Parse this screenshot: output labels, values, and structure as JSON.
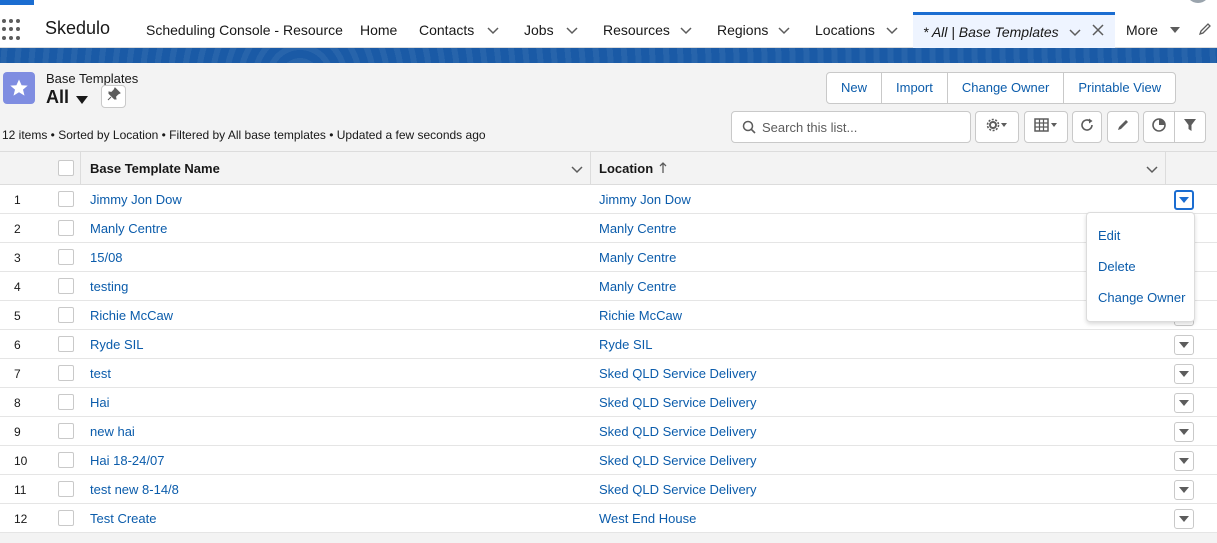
{
  "app": {
    "name": "Skedulo"
  },
  "nav": {
    "items": [
      {
        "label": "Scheduling Console - Resource",
        "has_menu": false
      },
      {
        "label": "Home",
        "has_menu": false
      },
      {
        "label": "Contacts",
        "has_menu": true
      },
      {
        "label": "Jobs",
        "has_menu": true
      },
      {
        "label": "Resources",
        "has_menu": true
      },
      {
        "label": "Regions",
        "has_menu": true
      },
      {
        "label": "Locations",
        "has_menu": true
      }
    ],
    "active_tab": "* All | Base Templates",
    "more_label": "More"
  },
  "header": {
    "object_label": "Base Templates",
    "view_name": "All",
    "buttons": [
      "New",
      "Import",
      "Change Owner",
      "Printable View"
    ],
    "meta": "12 items • Sorted by Location • Filtered by All base templates • Updated a few seconds ago",
    "search_placeholder": "Search this list..."
  },
  "table": {
    "columns": [
      {
        "label": "Base Template Name",
        "sorted": false
      },
      {
        "label": "Location",
        "sorted": true,
        "sort_direction": "ascending"
      }
    ],
    "rows": [
      {
        "num": "1",
        "name": "Jimmy Jon Dow",
        "location": "Jimmy Jon Dow"
      },
      {
        "num": "2",
        "name": "Manly Centre",
        "location": "Manly Centre"
      },
      {
        "num": "3",
        "name": "15/08",
        "location": "Manly Centre"
      },
      {
        "num": "4",
        "name": "testing",
        "location": "Manly Centre"
      },
      {
        "num": "5",
        "name": "Richie McCaw",
        "location": "Richie McCaw"
      },
      {
        "num": "6",
        "name": "Ryde SIL",
        "location": "Ryde SIL"
      },
      {
        "num": "7",
        "name": "test",
        "location": "Sked QLD Service Delivery"
      },
      {
        "num": "8",
        "name": "Hai",
        "location": "Sked QLD Service Delivery"
      },
      {
        "num": "9",
        "name": "new hai",
        "location": "Sked QLD Service Delivery"
      },
      {
        "num": "10",
        "name": "Hai 18-24/07",
        "location": "Sked QLD Service Delivery"
      },
      {
        "num": "11",
        "name": "test new 8-14/8",
        "location": "Sked QLD Service Delivery"
      },
      {
        "num": "12",
        "name": "Test Create",
        "location": "West End House"
      }
    ]
  },
  "row_menu": {
    "items": [
      "Edit",
      "Delete",
      "Change Owner"
    ],
    "open_row": 1
  },
  "colors": {
    "brand": "#1b6dd1",
    "link": "#0b5cab",
    "band": "#1a5aa6",
    "object_icon": "#7f8de1"
  },
  "icons": [
    "waffle-icon",
    "chevron-down-icon",
    "close-icon",
    "pencil-icon",
    "star-icon",
    "pin-icon",
    "search-icon",
    "gear-icon",
    "table-icon",
    "refresh-icon",
    "chart-icon",
    "filter-icon",
    "sort-arrow-up-icon"
  ]
}
